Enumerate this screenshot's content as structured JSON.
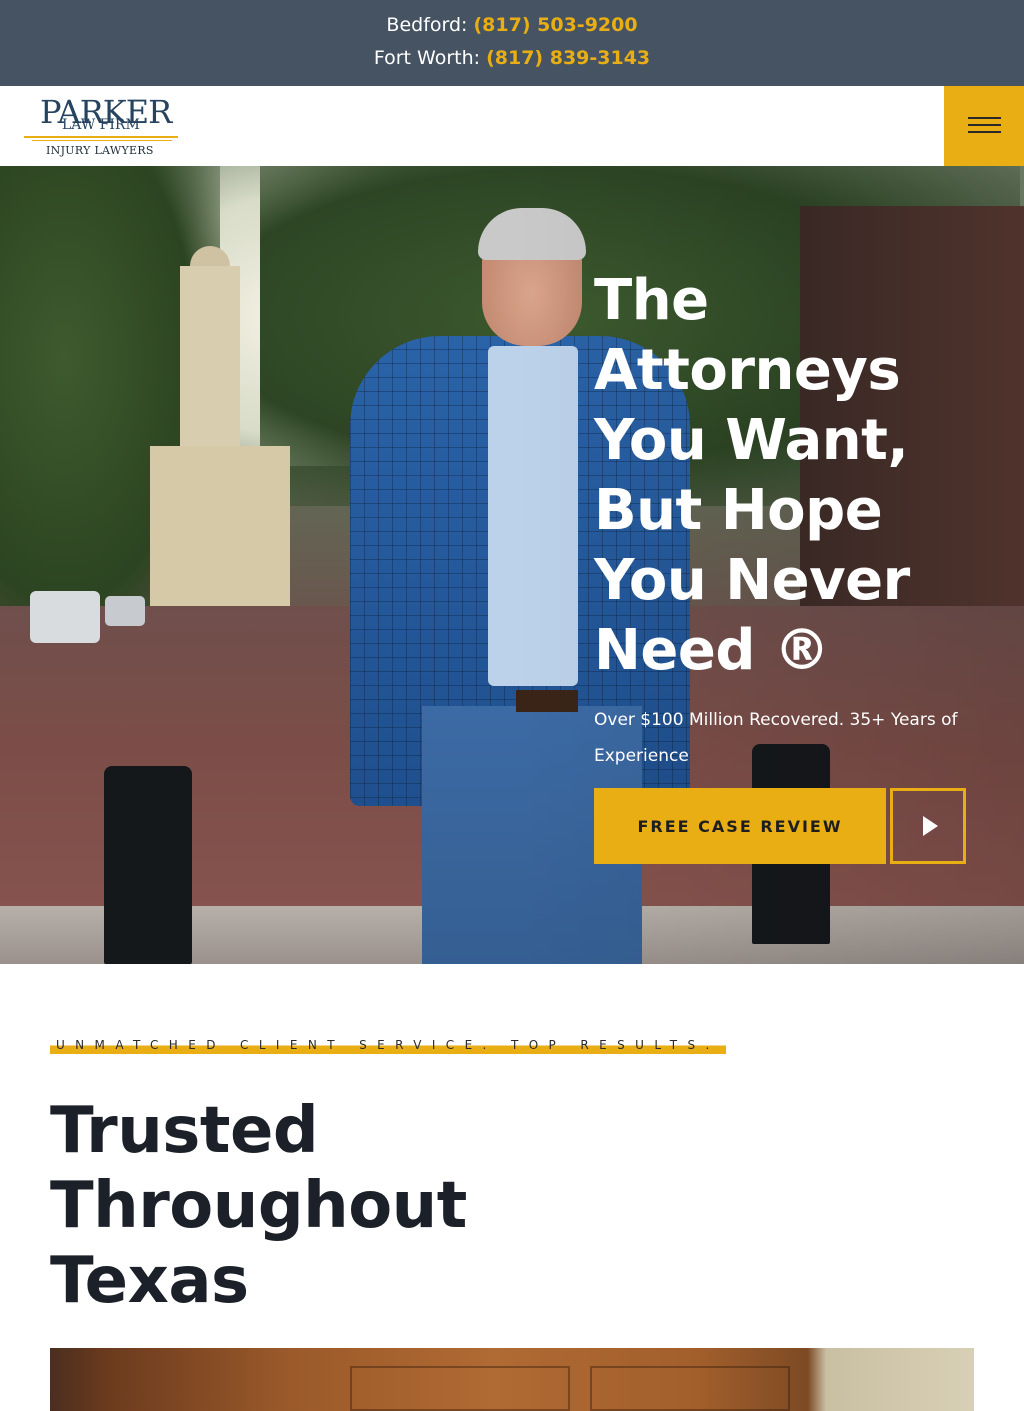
{
  "topbar": {
    "bedford_label": "Bedford:",
    "bedford_phone": "(817) 503-9200",
    "fortworth_label": "Fort Worth:",
    "fortworth_phone": "(817) 839-3143"
  },
  "logo": {
    "name": "PARKER",
    "line2": "LAW FIRM",
    "line3": "INJURY LAWYERS"
  },
  "header": {
    "menu_icon": "hamburger-menu-icon"
  },
  "hero": {
    "title": "The Attorneys You Want, But Hope You Never Need ®",
    "subtitle": "Over $100 Million Recovered. 35+ Years of Experience",
    "cta_label": "FREE CASE REVIEW",
    "play_icon": "play-icon"
  },
  "section": {
    "kicker": "UNMATCHED CLIENT SERVICE. TOP RESULTS.",
    "title": "Trusted Throughout Texas"
  },
  "colors": {
    "accent": "#e8ae13",
    "topbar_bg": "#465362",
    "heading": "#1c2129"
  }
}
